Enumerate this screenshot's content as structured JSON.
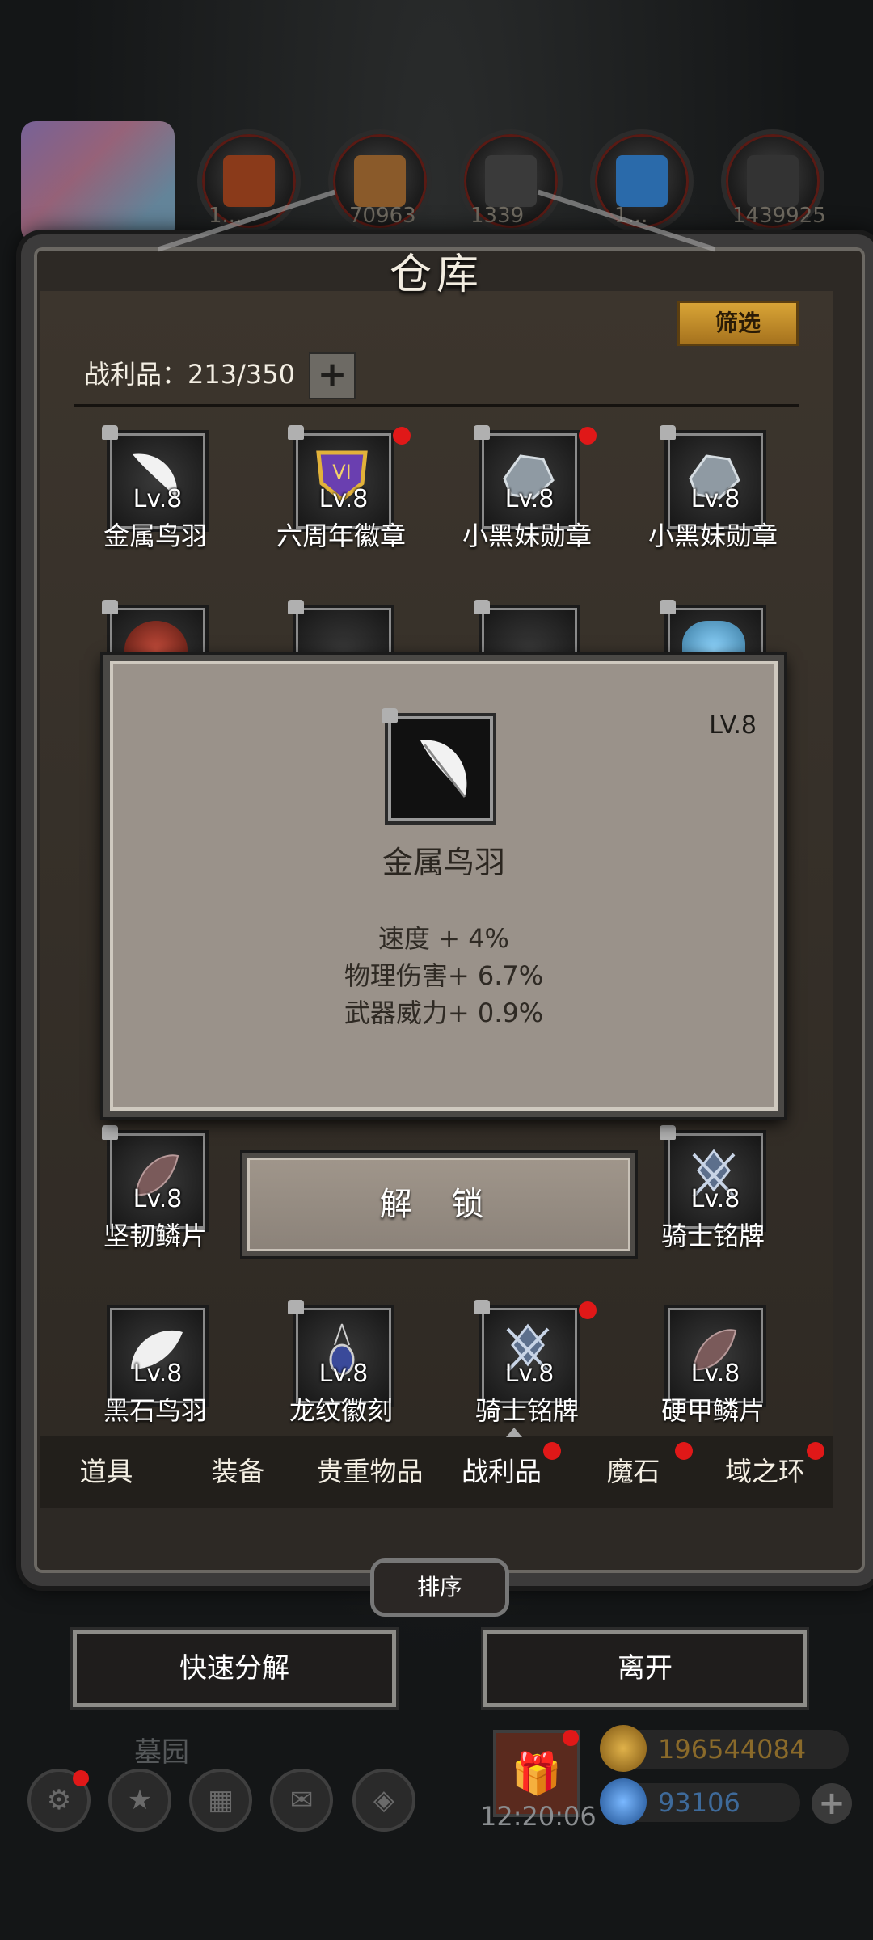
{
  "top_bar": {
    "numbers": [
      "1...",
      "70963",
      "1339",
      "1...",
      "1439925"
    ]
  },
  "dialog": {
    "title": "仓库",
    "filter_label": "筛选",
    "count_label": "战利品：213/350",
    "add_label": "+"
  },
  "items": [
    {
      "name": "金属鸟羽",
      "lv": "Lv.8",
      "locked": true,
      "new": false,
      "icon": "feather-icon"
    },
    {
      "name": "六周年徽章",
      "lv": "Lv.8",
      "locked": true,
      "new": true,
      "icon": "badge-icon"
    },
    {
      "name": "小黑妹勋章",
      "lv": "Lv.8",
      "locked": true,
      "new": true,
      "icon": "crystal-icon"
    },
    {
      "name": "小黑妹勋章",
      "lv": "Lv.8",
      "locked": true,
      "new": false,
      "icon": "crystal-icon"
    },
    {
      "name": "坚韧鳞片",
      "lv": "Lv.8",
      "locked": true,
      "new": false,
      "icon": "scale-icon"
    },
    {
      "name": "骑士铭牌",
      "lv": "Lv.8",
      "locked": true,
      "new": false,
      "icon": "knight-plate-icon"
    },
    {
      "name": "黑石鸟羽",
      "lv": "Lv.8",
      "locked": false,
      "new": false,
      "icon": "wing-icon"
    },
    {
      "name": "龙纹徽刻",
      "lv": "Lv.8",
      "locked": true,
      "new": false,
      "icon": "pendant-icon"
    },
    {
      "name": "骑士铭牌",
      "lv": "Lv.8",
      "locked": true,
      "new": true,
      "icon": "knight-plate-icon"
    },
    {
      "name": "硬甲鳞片",
      "lv": "Lv.8",
      "locked": false,
      "new": false,
      "icon": "scale-icon"
    }
  ],
  "popup": {
    "level": "LV.8",
    "name": "金属鸟羽",
    "stats": [
      "速度 + 4%",
      "物理伤害+ 6.7%",
      "武器威力+ 0.9%"
    ],
    "unlock_label": "解 锁"
  },
  "tabs": [
    {
      "label": "道具",
      "dot": false
    },
    {
      "label": "装备",
      "dot": false
    },
    {
      "label": "贵重物品",
      "dot": false
    },
    {
      "label": "战利品",
      "dot": true
    },
    {
      "label": "魔石",
      "dot": true
    },
    {
      "label": "域之环",
      "dot": true
    }
  ],
  "actions": {
    "sort_label": "排序",
    "decompose_label": "快速分解",
    "leave_label": "离开"
  },
  "bottom": {
    "location": "墓园",
    "clock": "12:20:06",
    "gold": "196544084",
    "gems": "93106"
  },
  "colors": {
    "accent_gold": "#d9a436",
    "notify_red": "#e01818"
  }
}
